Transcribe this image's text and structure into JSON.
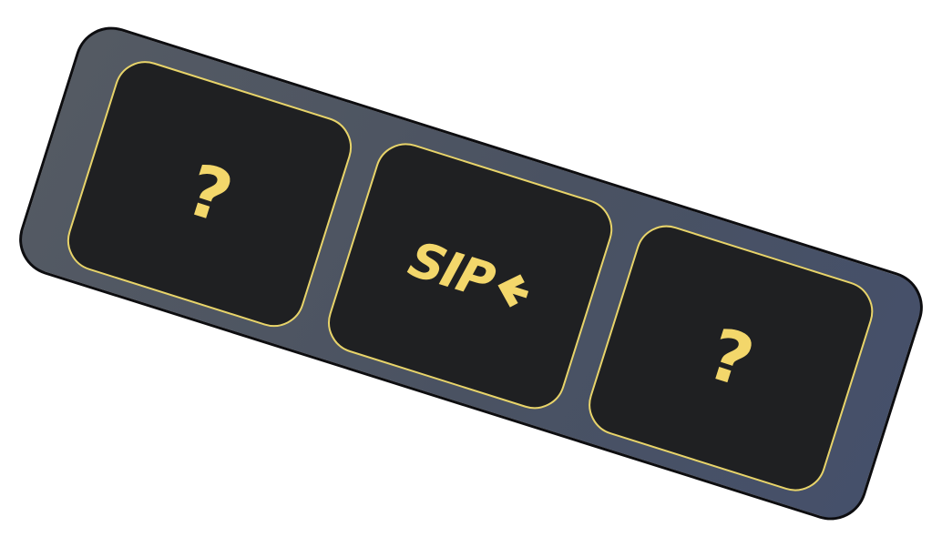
{
  "slots": [
    {
      "state": "hidden",
      "symbol": "?"
    },
    {
      "state": "revealed",
      "logo_text": "SIP"
    },
    {
      "state": "hidden",
      "symbol": "?"
    }
  ],
  "colors": {
    "tray_start": "#545a63",
    "tray_end": "#45506a",
    "slot_fill": "#1f2022",
    "accent_yellow": "#f3d76b",
    "slot_border": "#e8d46a",
    "outline": "#0d0d10"
  },
  "icons": {
    "logo_mark": "arrow-left-icon"
  }
}
